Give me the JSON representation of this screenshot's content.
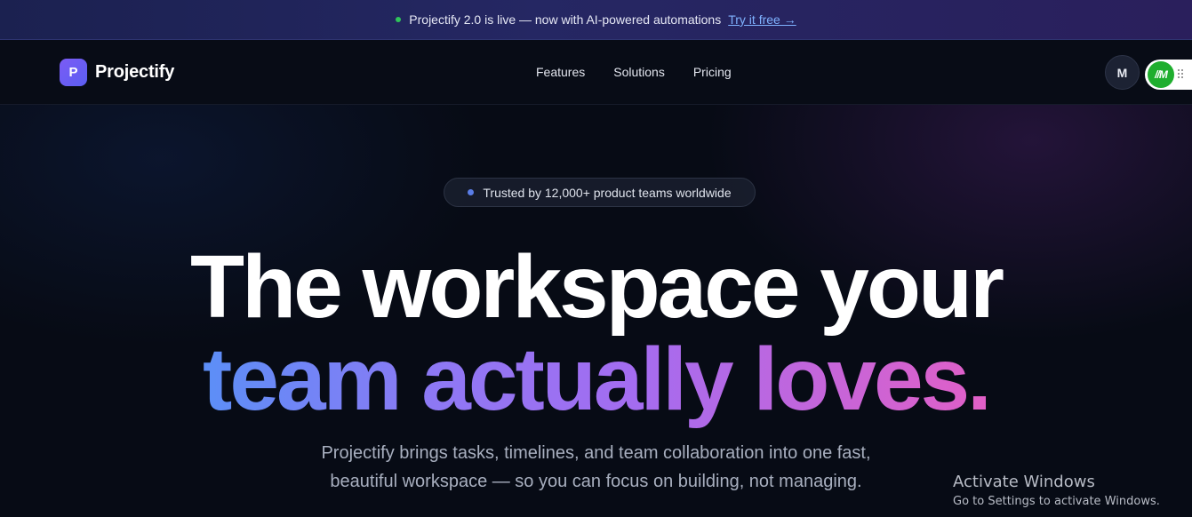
{
  "announcement": {
    "text": "Projectify 2.0 is live — now with AI-powered automations",
    "cta": "Try it free →",
    "dot_color": "#2fc45a"
  },
  "nav": {
    "logo_letter": "P",
    "brand": "Projectify",
    "links": [
      "Features",
      "Solutions",
      "Pricing"
    ],
    "avatar_initial": "M",
    "extension_label": "//M"
  },
  "hero": {
    "badge": "Trusted by 12,000+ product teams worldwide",
    "headline_line1": "The workspace your",
    "headline_line2": "team actually loves.",
    "subtitle_line1": "Projectify brings tasks, timelines, and team collaboration into one fast,",
    "subtitle_line2": "beautiful workspace — so you can focus on building, not managing.",
    "gradient_colors": [
      "#5b8ff7",
      "#8e78f4",
      "#a46cf0",
      "#e25fc6"
    ]
  },
  "os_watermark": {
    "title": "Activate Windows",
    "subtitle": "Go to Settings to activate Windows."
  },
  "icons": {
    "announce_dot": "status-dot-icon",
    "logo": "projectify-logo-icon",
    "extension": "browser-extension-icon",
    "grip": "drag-grip-icon"
  }
}
